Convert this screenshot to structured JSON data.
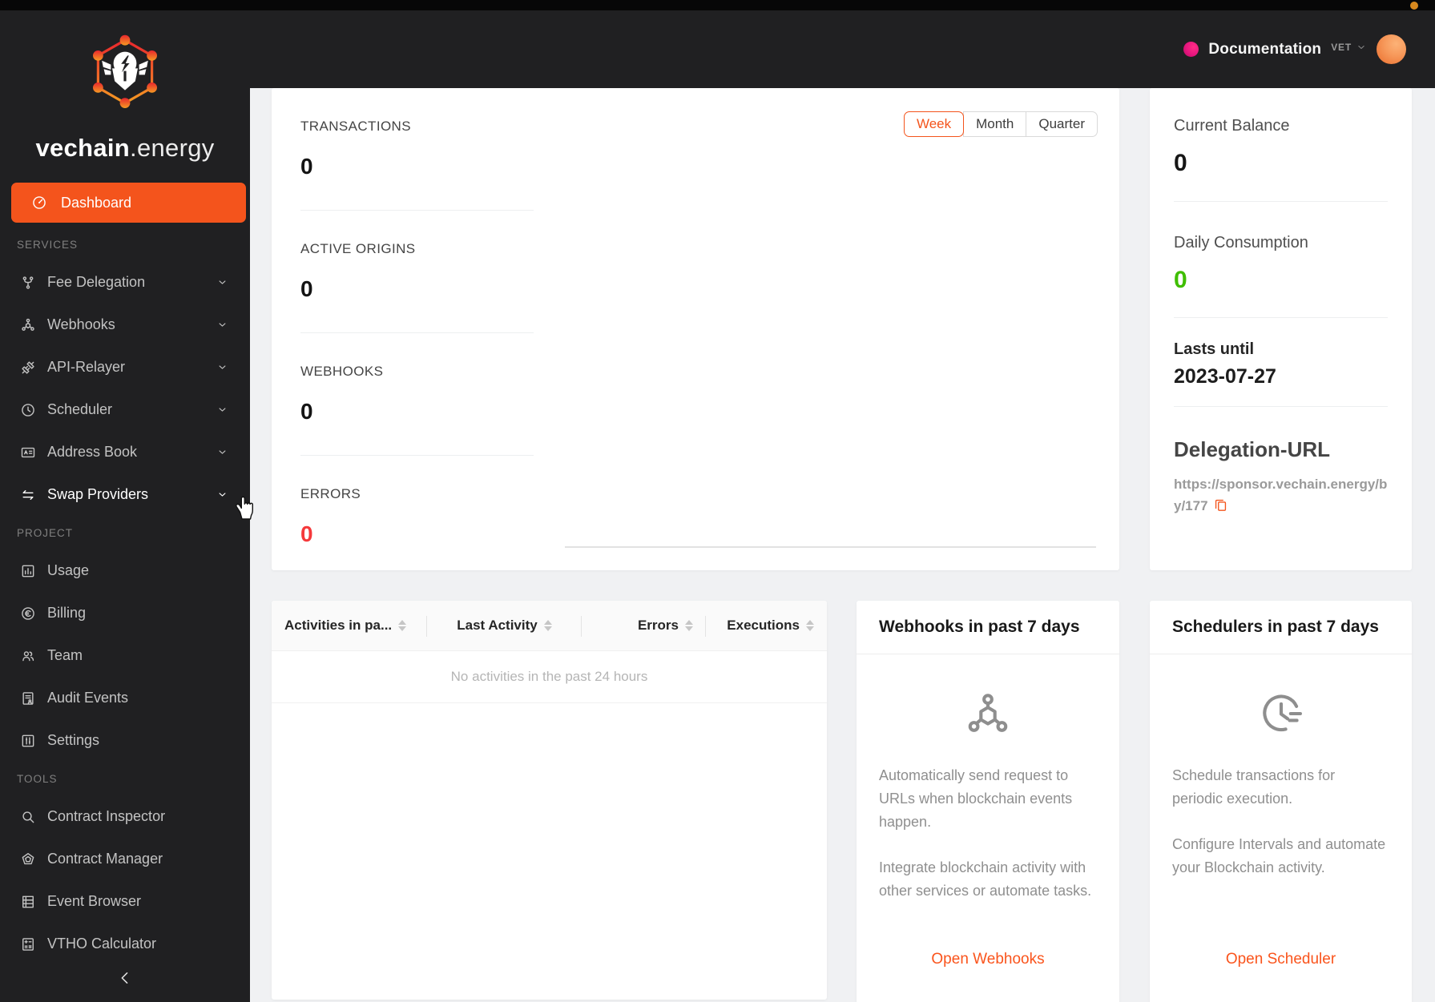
{
  "topbar": {
    "documentation_label": "Documentation",
    "network_selector": {
      "value": "VET"
    }
  },
  "brand": {
    "name_bold": "vechain",
    "name_light": ".energy"
  },
  "sidebar": {
    "dashboard_label": "Dashboard",
    "sections": [
      {
        "title": "SERVICES",
        "items": [
          {
            "label": "Fee Delegation",
            "icon": "fork"
          },
          {
            "label": "Webhooks",
            "icon": "nodes"
          },
          {
            "label": "API-Relayer",
            "icon": "api"
          },
          {
            "label": "Scheduler",
            "icon": "clock"
          },
          {
            "label": "Address Book",
            "icon": "idcard"
          },
          {
            "label": "Swap Providers",
            "icon": "swap"
          }
        ]
      },
      {
        "title": "PROJECT",
        "items": [
          {
            "label": "Usage",
            "icon": "chart"
          },
          {
            "label": "Billing",
            "icon": "euro"
          },
          {
            "label": "Team",
            "icon": "team"
          },
          {
            "label": "Audit Events",
            "icon": "audit"
          },
          {
            "label": "Settings",
            "icon": "sliders"
          }
        ]
      },
      {
        "title": "TOOLS",
        "items": [
          {
            "label": "Contract Inspector",
            "icon": "search"
          },
          {
            "label": "Contract Manager",
            "icon": "seal"
          },
          {
            "label": "Event Browser",
            "icon": "rows"
          },
          {
            "label": "VTHO Calculator",
            "icon": "calc"
          }
        ]
      }
    ]
  },
  "overview": {
    "period_selector": {
      "options": [
        "Week",
        "Month",
        "Quarter"
      ],
      "selected": "Week"
    },
    "stats": [
      {
        "label": "TRANSACTIONS",
        "value": "0"
      },
      {
        "label": "ACTIVE ORIGINS",
        "value": "0"
      },
      {
        "label": "WEBHOOKS",
        "value": "0"
      },
      {
        "label": "ERRORS",
        "value": "0"
      }
    ]
  },
  "balance_panel": {
    "sections": [
      {
        "label": "Current Balance",
        "value": "0"
      },
      {
        "label": "Daily Consumption",
        "value": "0"
      },
      {
        "label": "Lasts until",
        "value": "2023-07-27"
      },
      {
        "label": "Delegation-URL",
        "value": "https://sponsor.vechain.energy/by/177"
      }
    ]
  },
  "activities_table": {
    "columns": [
      {
        "label": "Activities in pa..."
      },
      {
        "label": "Last Activity"
      },
      {
        "label": "Errors"
      },
      {
        "label": "Executions"
      }
    ],
    "empty_text": "No activities in the past 24 hours"
  },
  "webhooks_card": {
    "title": "Webhooks in past 7 days",
    "paragraph1": "Automatically send request to URLs when blockchain events happen.",
    "paragraph2": "Integrate blockchain activity with other services or automate tasks.",
    "link_label": "Open Webhooks"
  },
  "schedulers_card": {
    "title": "Schedulers in past 7 days",
    "paragraph1": "Schedule transactions for periodic execution.",
    "paragraph2": "Configure Intervals and automate your Blockchain activity.",
    "link_label": "Open Scheduler"
  },
  "colors": {
    "accent_orange": "#f4541c",
    "link_orange": "#fa541c",
    "success_green": "#3fbe00",
    "error_red": "#f5393b",
    "dark_background": "#202022",
    "recording_dot": "#d8891e",
    "project_dot_pink": "#e6157e"
  }
}
